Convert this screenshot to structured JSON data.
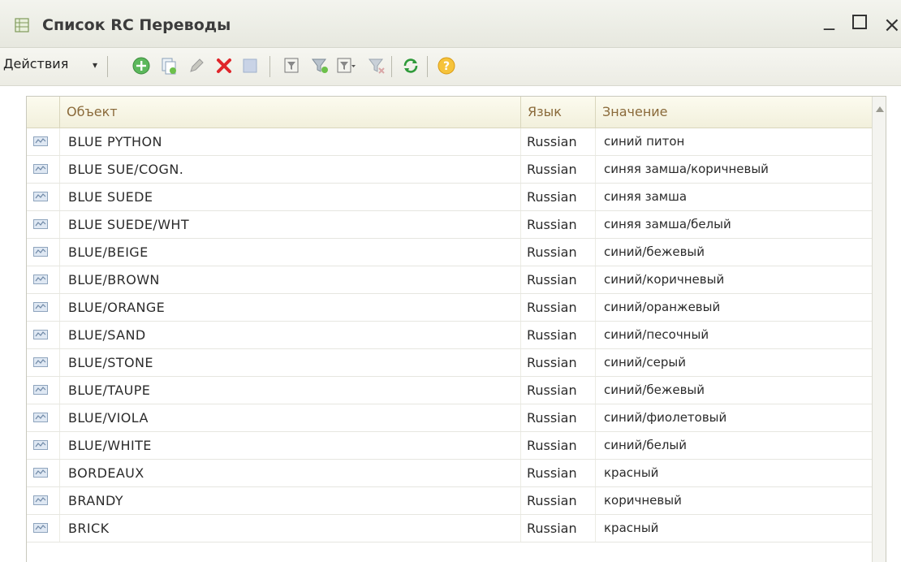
{
  "window": {
    "title": "Список RC Переводы",
    "controls": {
      "minimize": "_",
      "close": "×"
    }
  },
  "toolbar": {
    "actions_label": "Действия",
    "buttons": [
      "add-icon",
      "copy-icon",
      "edit-icon",
      "delete-icon",
      "mark-icon",
      "filter-icon",
      "filter-set-icon",
      "filter-menu-icon",
      "filter-clear-icon",
      "refresh-icon",
      "help-icon"
    ]
  },
  "grid": {
    "columns": [
      "Объект",
      "Язык",
      "Значение"
    ],
    "rows": [
      {
        "object": "BLUE PYTHON",
        "language": "Russian",
        "value": "синий питон"
      },
      {
        "object": "BLUE SUE/COGN.",
        "language": "Russian",
        "value": "синяя замша/коричневый"
      },
      {
        "object": "BLUE SUEDE",
        "language": "Russian",
        "value": "синяя замша"
      },
      {
        "object": "BLUE SUEDE/WHT",
        "language": "Russian",
        "value": "синяя замша/белый"
      },
      {
        "object": "BLUE/BEIGE",
        "language": "Russian",
        "value": "синий/бежевый"
      },
      {
        "object": "BLUE/BROWN",
        "language": "Russian",
        "value": "синий/коричневый"
      },
      {
        "object": "BLUE/ORANGE",
        "language": "Russian",
        "value": "синий/оранжевый"
      },
      {
        "object": "BLUE/SAND",
        "language": "Russian",
        "value": "синий/песочный"
      },
      {
        "object": "BLUE/STONE",
        "language": "Russian",
        "value": "синий/серый"
      },
      {
        "object": "BLUE/TAUPE",
        "language": "Russian",
        "value": "синий/бежевый"
      },
      {
        "object": "BLUE/VIOLA",
        "language": "Russian",
        "value": "синий/фиолетовый"
      },
      {
        "object": "BLUE/WHITE",
        "language": "Russian",
        "value": "синий/белый"
      },
      {
        "object": "BORDEAUX",
        "language": "Russian",
        "value": "красный"
      },
      {
        "object": "BRANDY",
        "language": "Russian",
        "value": "коричневый"
      },
      {
        "object": "BRICK",
        "language": "Russian",
        "value": "красный"
      }
    ]
  }
}
